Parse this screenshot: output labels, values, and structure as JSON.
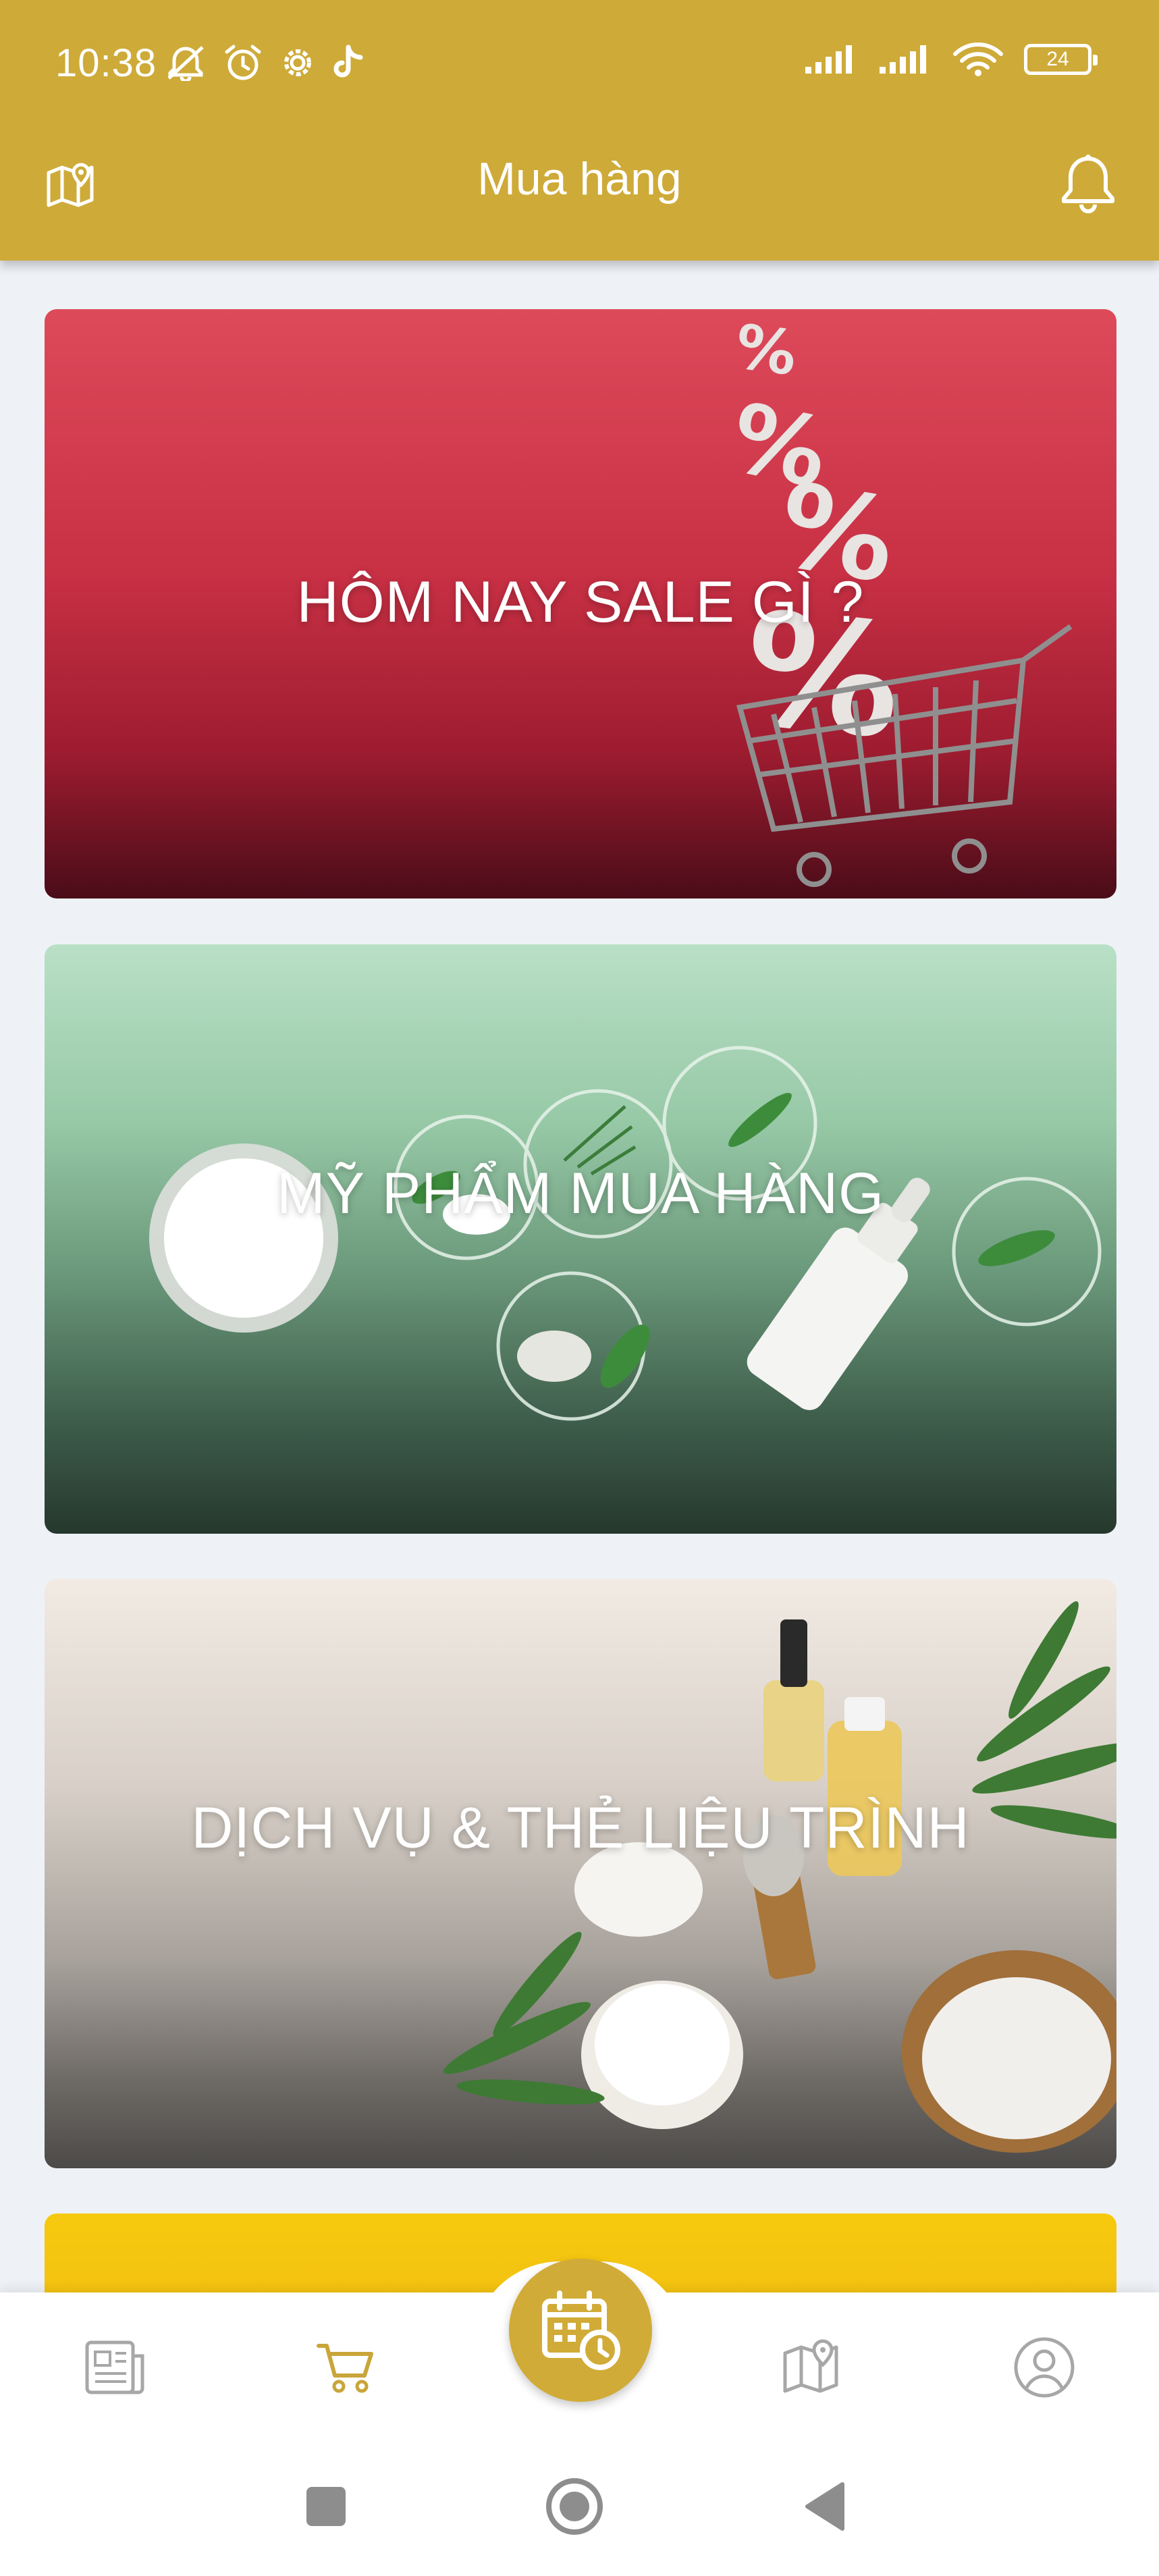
{
  "status_bar": {
    "time": "10:38",
    "battery_level": "24"
  },
  "app_bar": {
    "title": "Mua hàng"
  },
  "cards": [
    {
      "title": "HÔM NAY SALE GÌ ?"
    },
    {
      "title": "MỸ PHẨM MUA HÀNG"
    },
    {
      "title": "DỊCH VỤ & THẺ LIỆU TRÌNH"
    }
  ],
  "bottom_nav": {
    "active": "cart",
    "items": [
      {
        "key": "news",
        "icon": "newspaper-icon"
      },
      {
        "key": "cart",
        "icon": "cart-icon"
      },
      {
        "key": "booking",
        "icon": "calendar-clock-icon"
      },
      {
        "key": "map",
        "icon": "map-pin-icon"
      },
      {
        "key": "account",
        "icon": "user-circle-icon"
      }
    ]
  },
  "colors": {
    "brand": "#ceaa38",
    "accent_active": "#c9a53a",
    "nav_inactive": "#a7a7a7",
    "background": "#eef2f6"
  }
}
